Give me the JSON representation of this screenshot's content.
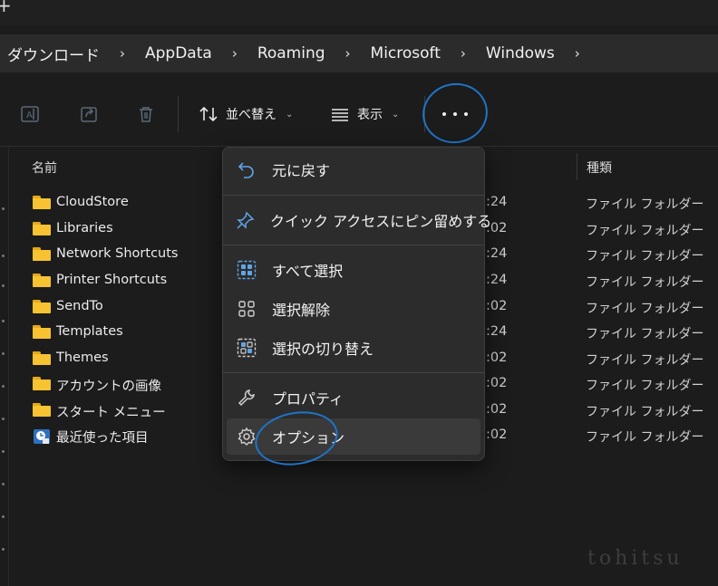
{
  "window": {
    "new_tab_glyph": "+"
  },
  "breadcrumbs": [
    "ダウンロード",
    "AppData",
    "Roaming",
    "Microsoft",
    "Windows"
  ],
  "breadcrumb_separator": "›",
  "toolbar": {
    "sort_label": "並べ替え",
    "view_label": "表示",
    "chevron": "⌄",
    "icons": [
      "rename-icon",
      "share-icon",
      "delete-icon",
      "sort-icon",
      "view-icon",
      "more-icon"
    ]
  },
  "columns": {
    "name": "名前",
    "type": "種類"
  },
  "files": [
    {
      "name": "CloudStore",
      "date": ":24",
      "type": "ファイル フォルダー",
      "icon": "folder-icon"
    },
    {
      "name": "Libraries",
      "date": ":02",
      "type": "ファイル フォルダー",
      "icon": "folder-icon"
    },
    {
      "name": "Network Shortcuts",
      "date": ":24",
      "type": "ファイル フォルダー",
      "icon": "folder-icon"
    },
    {
      "name": "Printer Shortcuts",
      "date": ":24",
      "type": "ファイル フォルダー",
      "icon": "folder-icon"
    },
    {
      "name": "SendTo",
      "date": ":02",
      "type": "ファイル フォルダー",
      "icon": "folder-icon"
    },
    {
      "name": "Templates",
      "date": ":24",
      "type": "ファイル フォルダー",
      "icon": "folder-icon"
    },
    {
      "name": "Themes",
      "date": ":02",
      "type": "ファイル フォルダー",
      "icon": "folder-icon"
    },
    {
      "name": "アカウントの画像",
      "date": ":02",
      "type": "ファイル フォルダー",
      "icon": "folder-icon"
    },
    {
      "name": "スタート メニュー",
      "date": ":02",
      "type": "ファイル フォルダー",
      "icon": "folder-icon"
    },
    {
      "name": "最近使った項目",
      "date": ":02",
      "type": "ファイル フォルダー",
      "icon": "recent-items-icon"
    }
  ],
  "context_menu": {
    "undo": "元に戻す",
    "pin_quick_access": "クイック アクセスにピン留めする",
    "select_all": "すべて選択",
    "select_none": "選択解除",
    "invert_selection": "選択の切り替え",
    "properties": "プロパティ",
    "options": "オプション"
  },
  "colors": {
    "accent": "#1f74c9",
    "folder": "#f7c332",
    "menu_bg": "#2c2c2c",
    "bg": "#1c1c1c"
  },
  "watermark": "tohitsu"
}
